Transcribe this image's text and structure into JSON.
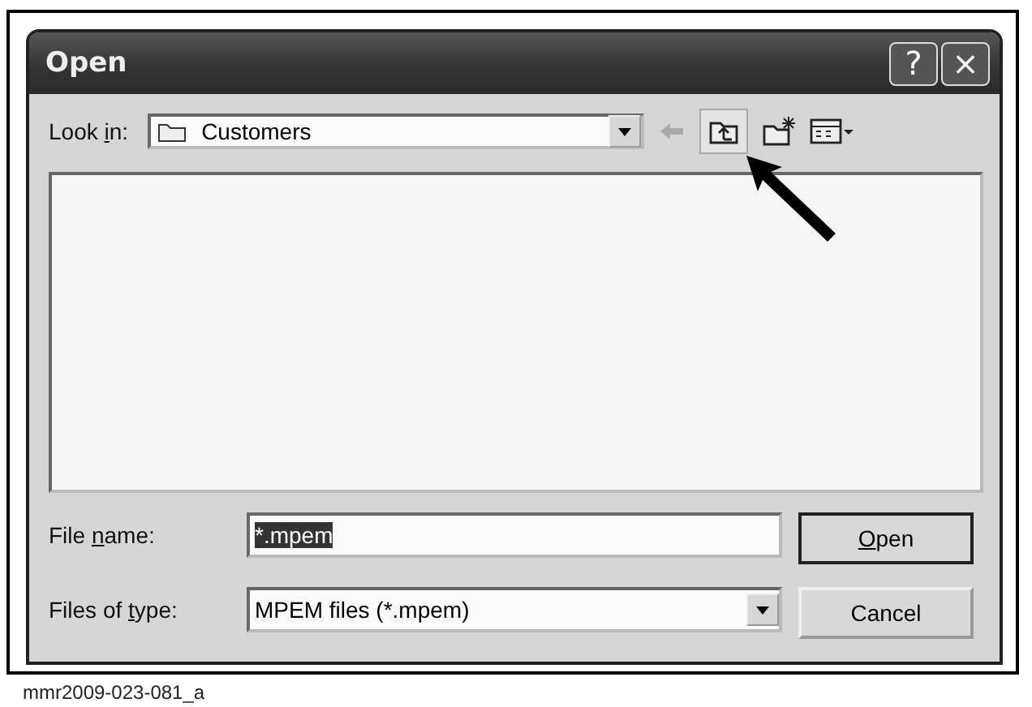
{
  "window": {
    "title": "Open",
    "help": "?",
    "close": "×"
  },
  "look_in": {
    "label_parts": [
      "Look ",
      "i",
      "n:"
    ],
    "value": "Customers"
  },
  "file_name": {
    "label_parts": [
      "File ",
      "n",
      "ame:"
    ],
    "value": "*.mpem",
    "selected": true
  },
  "file_type": {
    "label_parts": [
      "Files of ",
      "t",
      "ype:"
    ],
    "value": "MPEM files (*.mpem)"
  },
  "buttons": [
    {
      "label": [
        {
          "text": "O",
          "underlined": true
        },
        {
          "text": "pen",
          "underlined": false
        }
      ],
      "default": true
    },
    {
      "label": [
        {
          "text": "Cancel",
          "underlined": false
        }
      ],
      "default": false
    }
  ],
  "caption": "mmr2009-023-081_a"
}
